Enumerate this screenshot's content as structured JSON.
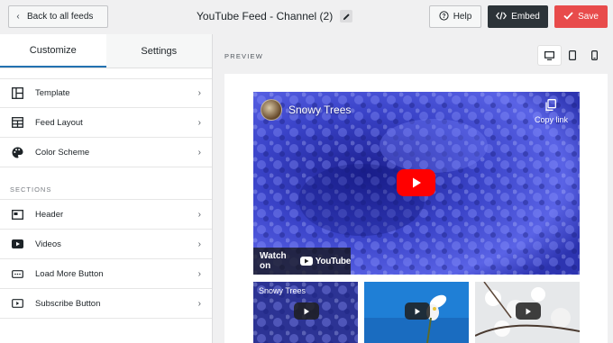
{
  "header": {
    "back_label": "Back to all feeds",
    "title": "YouTube Feed - Channel (2)",
    "help_label": "Help",
    "embed_label": "Embed",
    "save_label": "Save"
  },
  "sidebar": {
    "tabs": [
      {
        "label": "Customize",
        "active": true
      },
      {
        "label": "Settings",
        "active": false
      }
    ],
    "items": [
      {
        "label": "Template",
        "icon": "template-icon"
      },
      {
        "label": "Feed Layout",
        "icon": "feed-layout-icon"
      },
      {
        "label": "Color Scheme",
        "icon": "palette-icon"
      }
    ],
    "sections_title": "SECTIONS",
    "section_items": [
      {
        "label": "Header",
        "icon": "header-icon"
      },
      {
        "label": "Videos",
        "icon": "videos-icon"
      },
      {
        "label": "Load More Button",
        "icon": "load-more-icon"
      },
      {
        "label": "Subscribe Button",
        "icon": "subscribe-icon"
      }
    ]
  },
  "preview": {
    "label": "PREVIEW",
    "devices": [
      "desktop-icon",
      "tablet-icon",
      "mobile-icon"
    ],
    "active_device": "desktop-icon",
    "video": {
      "channel_name": "Snowy Trees",
      "copy_link": "Copy link",
      "watch_on": "Watch on",
      "youtube": "YouTube"
    },
    "thumbnails": [
      {
        "title": "Snowy Trees"
      },
      {
        "title": ""
      },
      {
        "title": ""
      }
    ]
  },
  "colors": {
    "embed": "#2c3338",
    "save": "#e84b4b",
    "accent": "#2271b1",
    "play": "#ff0000"
  }
}
